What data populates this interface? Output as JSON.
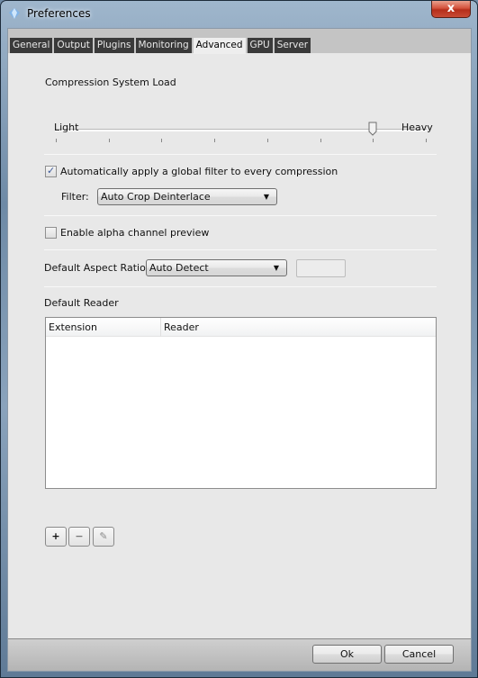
{
  "window": {
    "title": "Preferences",
    "close_label": "x"
  },
  "tabs": [
    {
      "label": "General",
      "active": false
    },
    {
      "label": "Output",
      "active": false
    },
    {
      "label": "Plugins",
      "active": false
    },
    {
      "label": "Monitoring",
      "active": false
    },
    {
      "label": "Advanced",
      "active": true
    },
    {
      "label": "GPU",
      "active": false
    },
    {
      "label": "Server",
      "active": false
    }
  ],
  "load": {
    "label": "Compression System Load",
    "min_label": "Light",
    "max_label": "Heavy",
    "tick_count": 8,
    "value_index": 6,
    "max_index": 7
  },
  "global_filter": {
    "checkbox_label": "Automatically apply a global filter to every compression",
    "checked": true,
    "filter_label": "Filter:",
    "filter_value": "Auto Crop Deinterlace"
  },
  "alpha_preview": {
    "checkbox_label": "Enable alpha channel preview",
    "checked": false
  },
  "aspect_ratio": {
    "label": "Default Aspect Ratio:",
    "value": "Auto Detect",
    "custom_value": ""
  },
  "default_reader": {
    "label": "Default Reader",
    "columns": [
      "Extension",
      "Reader"
    ],
    "rows": []
  },
  "reader_buttons": {
    "add": "+",
    "remove": "−",
    "edit": "✎"
  },
  "footer": {
    "ok_label": "Ok",
    "cancel_label": "Cancel"
  }
}
